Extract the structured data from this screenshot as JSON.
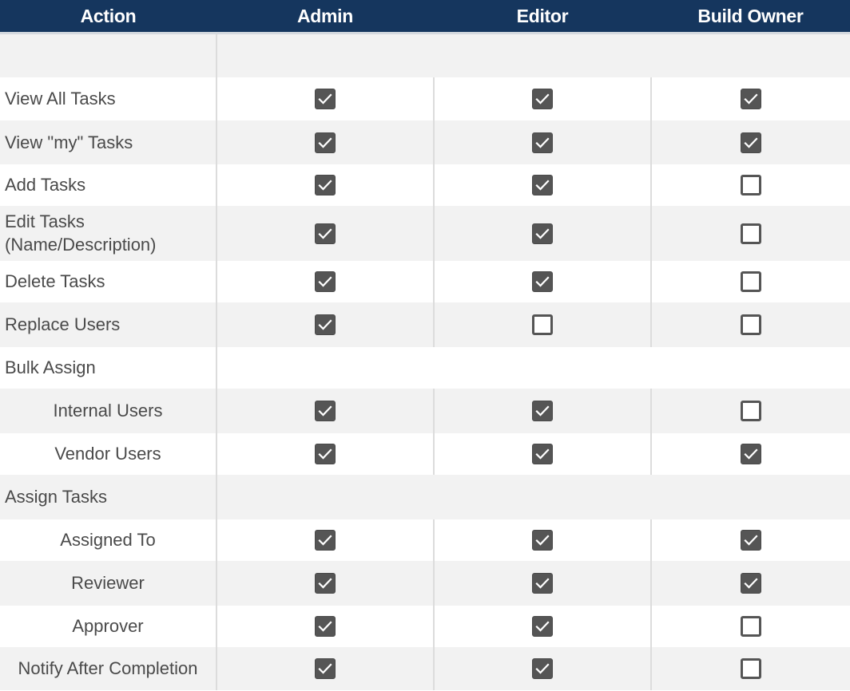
{
  "table": {
    "headers": [
      "Action",
      "Admin",
      "Editor",
      "Build Owner"
    ],
    "rows": [
      {
        "type": "blank",
        "label": ""
      },
      {
        "type": "item",
        "label": "View All Tasks",
        "indent": false,
        "values": [
          true,
          true,
          true
        ]
      },
      {
        "type": "item",
        "label": "View \"my\" Tasks",
        "indent": false,
        "values": [
          true,
          true,
          true
        ]
      },
      {
        "type": "item",
        "label": "Add Tasks",
        "indent": false,
        "values": [
          true,
          true,
          false
        ]
      },
      {
        "type": "item",
        "label": "Edit Tasks (Name/Description)",
        "indent": false,
        "values": [
          true,
          true,
          false
        ]
      },
      {
        "type": "item",
        "label": "Delete Tasks",
        "indent": false,
        "values": [
          true,
          true,
          false
        ]
      },
      {
        "type": "item",
        "label": "Replace Users",
        "indent": false,
        "values": [
          true,
          false,
          false
        ]
      },
      {
        "type": "section",
        "label": "Bulk Assign"
      },
      {
        "type": "item",
        "label": "Internal Users",
        "indent": true,
        "values": [
          true,
          true,
          false
        ]
      },
      {
        "type": "item",
        "label": "Vendor Users",
        "indent": true,
        "values": [
          true,
          true,
          true
        ]
      },
      {
        "type": "section",
        "label": "Assign Tasks"
      },
      {
        "type": "item",
        "label": "Assigned To",
        "indent": true,
        "values": [
          true,
          true,
          true
        ]
      },
      {
        "type": "item",
        "label": "Reviewer",
        "indent": true,
        "values": [
          true,
          true,
          true
        ]
      },
      {
        "type": "item",
        "label": "Approver",
        "indent": true,
        "values": [
          true,
          true,
          false
        ]
      },
      {
        "type": "item",
        "label": "Notify After Completion",
        "indent": true,
        "values": [
          true,
          true,
          false
        ]
      }
    ]
  },
  "colors": {
    "header_bg": "#15365e",
    "header_text": "#ffffff",
    "row_alt": "#f2f2f2",
    "checkbox": "#555555"
  },
  "icons": {
    "checked": "checkbox-checked-icon",
    "unchecked": "checkbox-unchecked-icon"
  }
}
